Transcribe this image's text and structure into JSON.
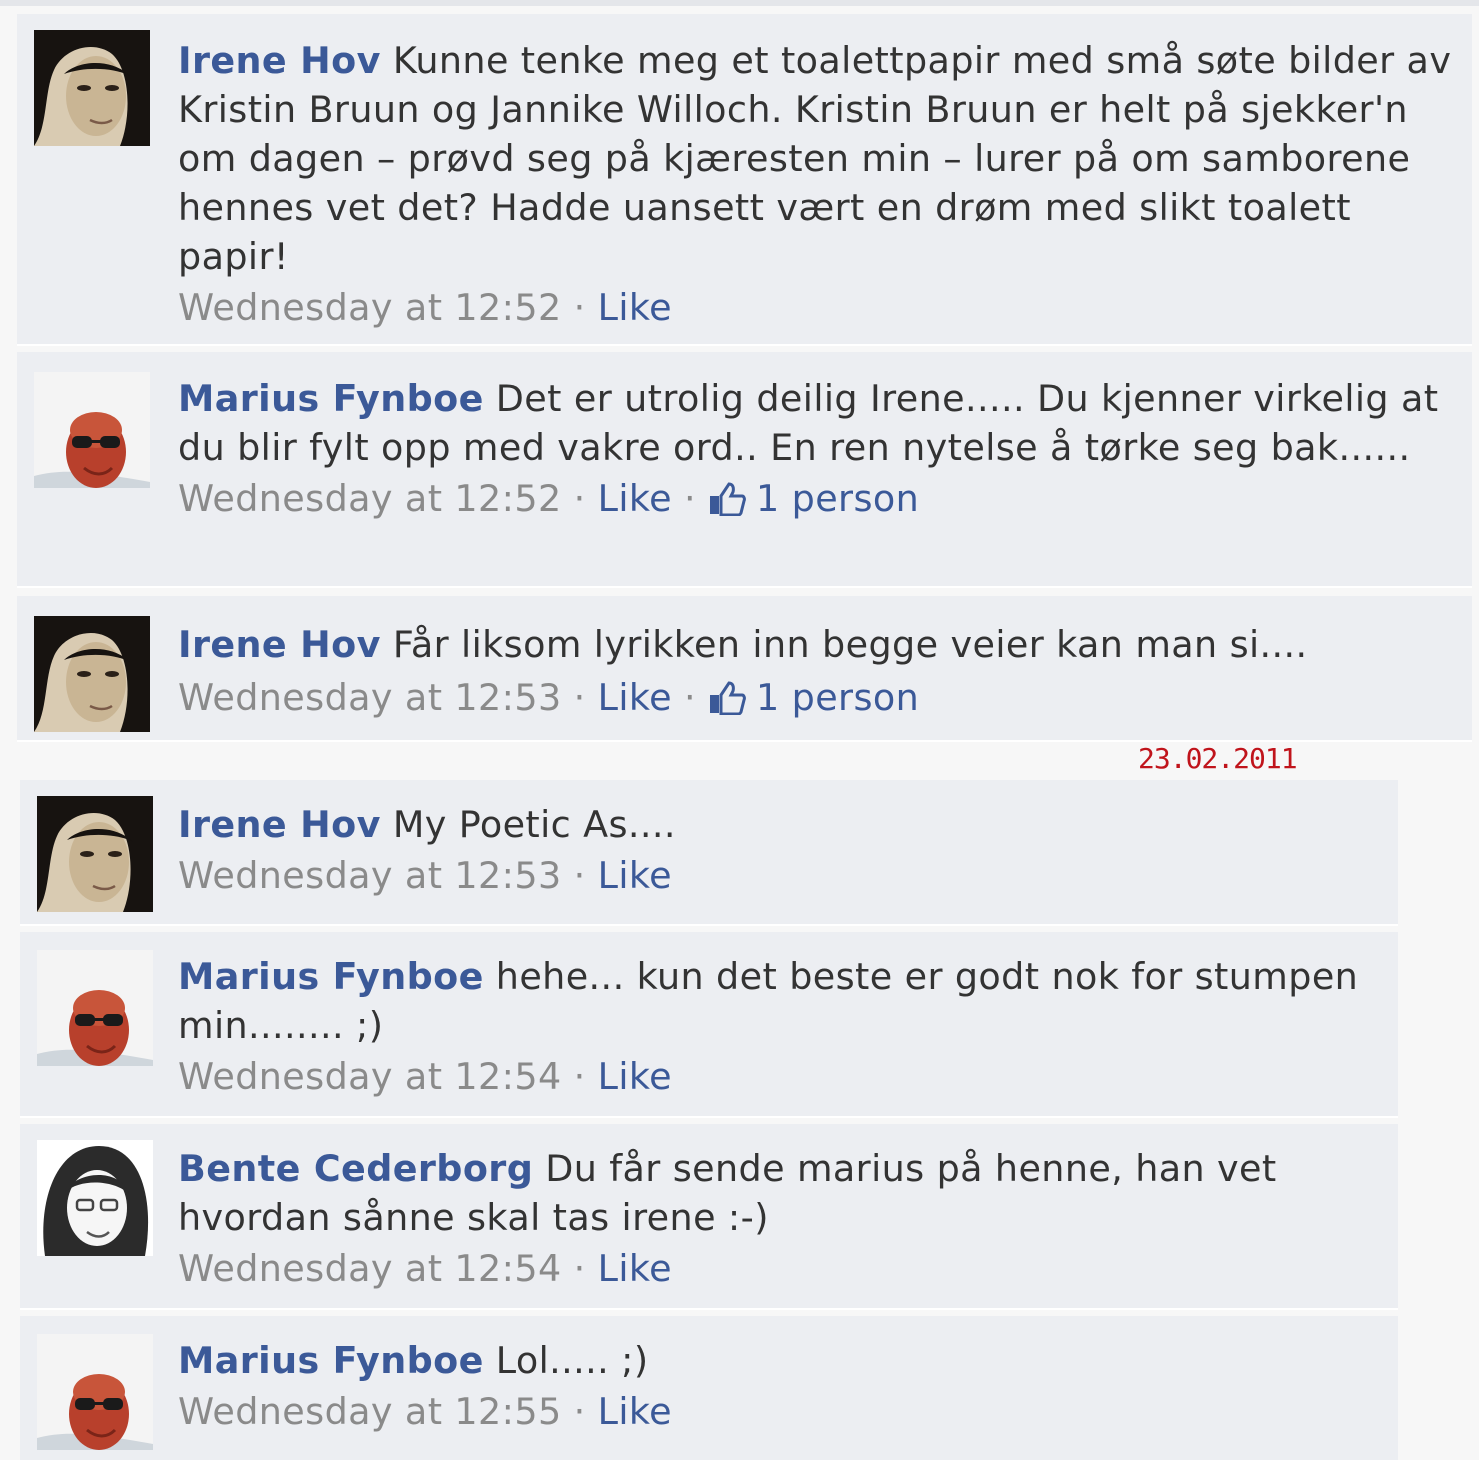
{
  "date_stamp": "23.02.2011",
  "comments": [
    {
      "author": "Irene Hov",
      "text": "Kunne tenke meg et toalettpapir med små søte bilder av Kristin Bruun og Jannike Willoch. Kristin Bruun er helt på sjekker'n om dagen – prøvd seg på kjæresten min – lurer på om samborene hennes vet det? Hadde uansett vært en drøm med slikt toalett papir!",
      "timestamp": "Wednesday at 12:52",
      "like_label": "Like",
      "avatar": "woman-dark-hair"
    },
    {
      "author": "Marius Fynboe",
      "text": "Det er utrolig deilig Irene..... Du kjenner virkelig at du blir fylt opp med vakre ord.. En ren nytelse å tørke seg bak......",
      "timestamp": "Wednesday at 12:52",
      "like_label": "Like",
      "likes_count": "1 person",
      "avatar": "man-sunglasses"
    },
    {
      "author": "Irene Hov",
      "text": "Får liksom lyrikken inn begge veier kan man si....",
      "timestamp": "Wednesday at 12:53",
      "like_label": "Like",
      "likes_count": "1 person",
      "avatar": "woman-dark-hair"
    },
    {
      "author": "Irene Hov",
      "text": "My Poetic As....",
      "timestamp": "Wednesday at 12:53",
      "like_label": "Like",
      "avatar": "woman-dark-hair"
    },
    {
      "author": "Marius Fynboe",
      "text": "hehe... kun det beste er godt nok for stumpen min........ ;)",
      "timestamp": "Wednesday at 12:54",
      "like_label": "Like",
      "avatar": "man-sunglasses"
    },
    {
      "author": "Bente Cederborg",
      "text": "Du får sende marius på henne, han vet hvordan sånne skal tas irene :-)",
      "timestamp": "Wednesday at 12:54",
      "like_label": "Like",
      "avatar": "woman-curly-hair"
    },
    {
      "author": "Marius Fynboe",
      "text": "Lol..... ;)",
      "timestamp": "Wednesday at 12:55",
      "like_label": "Like",
      "avatar": "man-sunglasses"
    }
  ],
  "colors": {
    "author_link": "#3b5998",
    "body_text": "#333333",
    "meta_text": "#8a8a8a",
    "comment_bg": "#eceef2",
    "date_stamp": "#c0141b"
  }
}
